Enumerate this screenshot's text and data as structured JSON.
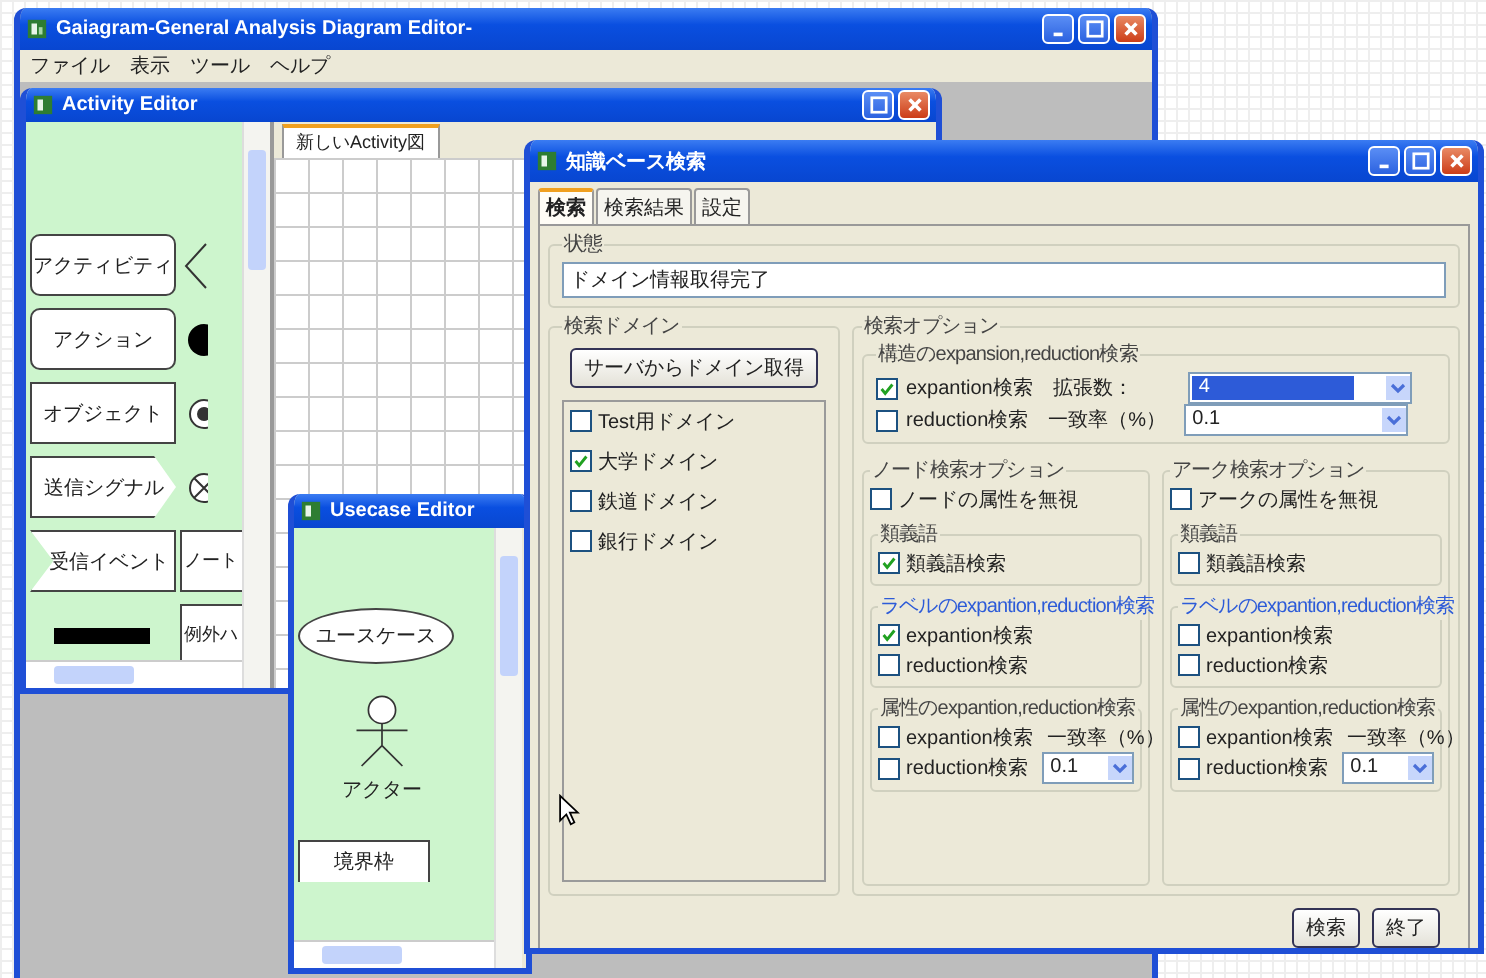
{
  "main_window": {
    "title": "Gaiagram-General Analysis Diagram Editor-",
    "menu": [
      "ファイル",
      "表示",
      "ツール",
      "ヘルプ"
    ]
  },
  "activity_editor": {
    "title": "Activity Editor",
    "tab": "新しいActivity図",
    "palette": [
      {
        "kind": "activity",
        "label": "アクティビティ"
      },
      {
        "kind": "decision"
      },
      {
        "kind": "action",
        "label": "アクション"
      },
      {
        "kind": "initial"
      },
      {
        "kind": "object",
        "label": "オブジェクト"
      },
      {
        "kind": "final"
      },
      {
        "kind": "send-signal",
        "label": "送信シグナル"
      },
      {
        "kind": "flow-final"
      },
      {
        "kind": "receive-event",
        "label": "受信イベント"
      },
      {
        "kind": "note",
        "label": "ノート"
      },
      {
        "kind": "fork-bar"
      },
      {
        "kind": "exception",
        "label": "例外ハ"
      }
    ]
  },
  "usecase_editor": {
    "title": "Usecase Editor",
    "palette": [
      {
        "kind": "usecase",
        "label": "ユースケース"
      },
      {
        "kind": "actor",
        "label": "アクター"
      },
      {
        "kind": "boundary",
        "label": "境界枠"
      }
    ]
  },
  "search_dialog": {
    "title": "知識ベース検索",
    "tabs": [
      {
        "label": "検索",
        "selected": true
      },
      {
        "label": "検索結果",
        "selected": false
      },
      {
        "label": "設定",
        "selected": false
      }
    ],
    "status": {
      "label": "状態",
      "value": "ドメイン情報取得完了"
    },
    "domain": {
      "label": "検索ドメイン",
      "button": "サーバからドメイン取得",
      "items": [
        {
          "label": "Test用ドメイン",
          "checked": false
        },
        {
          "label": "大学ドメイン",
          "checked": true
        },
        {
          "label": "鉄道ドメイン",
          "checked": false
        },
        {
          "label": "銀行ドメイン",
          "checked": false
        }
      ]
    },
    "options": {
      "label": "検索オプション",
      "structure": {
        "label": "構造のexpansion,reduction検索",
        "rows": [
          {
            "label": "expantion検索",
            "checked": true,
            "field_label": "拡張数：",
            "value": "4",
            "highlighted": true
          },
          {
            "label": "reduction検索",
            "checked": false,
            "field_label": "一致率（%）",
            "value": "0.1",
            "highlighted": false
          }
        ]
      },
      "groups": [
        {
          "label": "ノード検索オプション",
          "ignore": {
            "label": "ノードの属性を無視",
            "checked": false
          },
          "synonym": {
            "label": "類義語",
            "item": {
              "label": "類義語検索",
              "checked": true
            }
          },
          "label_search": {
            "label": "ラベルのexpantion,reduction検索",
            "items": [
              {
                "label": "expantion検索",
                "checked": true
              },
              {
                "label": "reduction検索",
                "checked": false
              }
            ]
          },
          "attribute_search": {
            "label": "属性のexpantion,reduction検索",
            "rows": [
              {
                "kind": "note",
                "label": "expantion検索",
                "checked": false,
                "note": "一致率（%）"
              },
              {
                "kind": "select",
                "label": "reduction検索",
                "checked": false,
                "value": "0.1"
              }
            ]
          }
        },
        {
          "label": "アーク検索オプション",
          "ignore": {
            "label": "アークの属性を無視",
            "checked": false
          },
          "synonym": {
            "label": "類義語",
            "item": {
              "label": "類義語検索",
              "checked": false
            }
          },
          "label_search": {
            "label": "ラベルのexpantion,reduction検索",
            "items": [
              {
                "label": "expantion検索",
                "checked": false
              },
              {
                "label": "reduction検索",
                "checked": false
              }
            ]
          },
          "attribute_search": {
            "label": "属性のexpantion,reduction検索",
            "rows": [
              {
                "kind": "note",
                "label": "expantion検索",
                "checked": false,
                "note": "一致率（%）"
              },
              {
                "kind": "select",
                "label": "reduction検索",
                "checked": false,
                "value": "0.1"
              }
            ]
          }
        }
      ]
    },
    "buttons": [
      "検索",
      "終了"
    ]
  }
}
